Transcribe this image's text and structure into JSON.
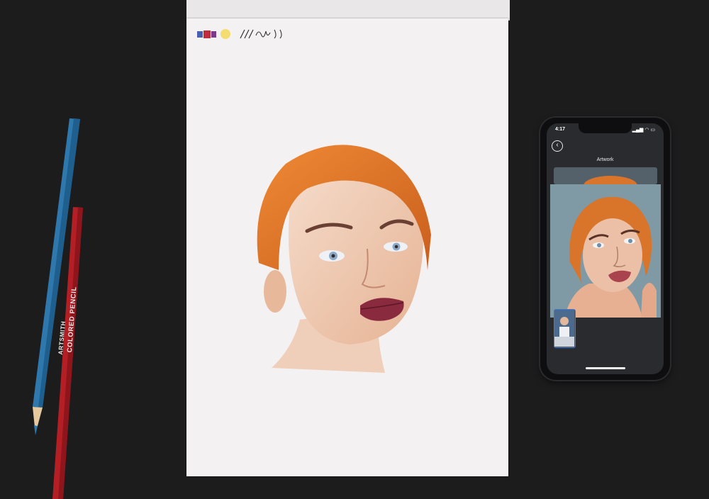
{
  "sketchbook": {
    "scribble_text": "/// ule )J"
  },
  "pencils": {
    "blue": {
      "color": "#2f78ad"
    },
    "red": {
      "color": "#b31f25",
      "brand": "ARTSMITH",
      "label": "COLORED PENCIL"
    }
  },
  "phone": {
    "status_time": "4:17",
    "status_icons": "▂▄▆ ◠ ▭",
    "back_icon": "chevron-left-icon",
    "back_glyph": "‹",
    "screen_title": "Artwork"
  },
  "colors": {
    "background": "#1c1c1d",
    "paper": "#f4f1f2",
    "hair": "#e0792a",
    "lips": "#8a2a3e",
    "skin": "#efc9b0"
  }
}
